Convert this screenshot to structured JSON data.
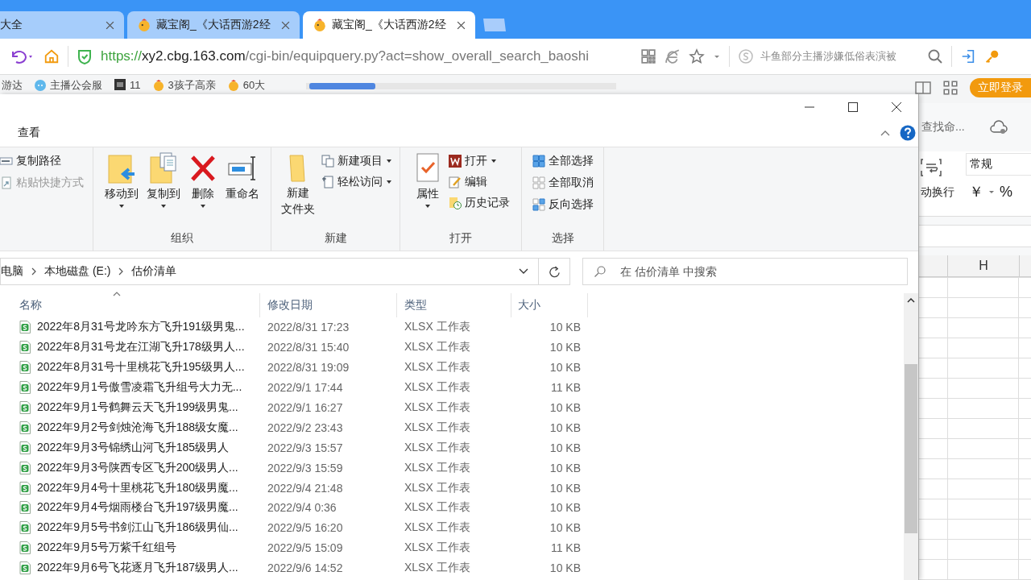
{
  "browser": {
    "tabs": [
      {
        "label": "大全",
        "selected": false,
        "favicon": false
      },
      {
        "label": "藏宝阁_《大话西游2经",
        "selected": false,
        "favicon": true
      },
      {
        "label": "藏宝阁_《大话西游2经",
        "selected": true,
        "favicon": true
      }
    ],
    "address": {
      "scheme": "https://",
      "host": "xy2.cbg.163.com",
      "path": "/cgi-bin/equipquery.py?act=show_overall_search_baoshi"
    },
    "search_text": "斗鱼部分主播涉嫌低俗表演被",
    "bookmarks": [
      {
        "label": "游达",
        "kind": "plain"
      },
      {
        "label": "主播公会服",
        "kind": "cloud"
      },
      {
        "label": "11",
        "kind": "dark"
      },
      {
        "label": "3孩子高亲",
        "kind": "chick"
      },
      {
        "label": "60大",
        "kind": "chick"
      }
    ],
    "login_button": "立即登录"
  },
  "explorer": {
    "ribbon_tab": "查看",
    "ribbon": {
      "clipboard": {
        "items": [
          {
            "label": "复制路径",
            "disabled": false
          },
          {
            "label": "粘贴快捷方式",
            "disabled": true
          }
        ]
      },
      "organize": {
        "label": "组织",
        "items": [
          {
            "label": "移动到",
            "dropdown": true
          },
          {
            "label": "复制到",
            "dropdown": true
          },
          {
            "label": "删除",
            "dropdown": true
          },
          {
            "label": "重命名",
            "dropdown": false
          }
        ]
      },
      "new": {
        "label": "新建",
        "folder": [
          "新建",
          "文件夹"
        ],
        "items": [
          {
            "label": "新建项目",
            "dropdown": true
          },
          {
            "label": "轻松访问",
            "dropdown": true
          }
        ]
      },
      "open": {
        "label": "打开",
        "properties": "属性",
        "items": [
          {
            "label": "打开",
            "dropdown": true
          },
          {
            "label": "编辑",
            "dropdown": false
          },
          {
            "label": "历史记录",
            "dropdown": false
          }
        ]
      },
      "select": {
        "label": "选择",
        "items": [
          "全部选择",
          "全部取消",
          "反向选择"
        ]
      }
    },
    "breadcrumb": [
      "电脑",
      "本地磁盘 (E:)",
      "估价清单"
    ],
    "search_placeholder": "在 估价清单 中搜索",
    "columns": [
      "名称",
      "修改日期",
      "类型",
      "大小"
    ],
    "files": [
      {
        "name": "2022年8月31号龙吟东方飞升191级男鬼...",
        "date": "2022/8/31 17:23",
        "type": "XLSX 工作表",
        "size": "10 KB"
      },
      {
        "name": "2022年8月31号龙在江湖飞升178级男人...",
        "date": "2022/8/31 15:40",
        "type": "XLSX 工作表",
        "size": "10 KB"
      },
      {
        "name": "2022年8月31号十里桃花飞升195级男人...",
        "date": "2022/8/31 19:09",
        "type": "XLSX 工作表",
        "size": "10 KB"
      },
      {
        "name": "2022年9月1号傲雪凌霜飞升组号大力无...",
        "date": "2022/9/1 17:44",
        "type": "XLSX 工作表",
        "size": "11 KB"
      },
      {
        "name": "2022年9月1号鹤舞云天飞升199级男鬼...",
        "date": "2022/9/1 16:27",
        "type": "XLSX 工作表",
        "size": "10 KB"
      },
      {
        "name": "2022年9月2号剑烛沧海飞升188级女魔...",
        "date": "2022/9/2 23:43",
        "type": "XLSX 工作表",
        "size": "10 KB"
      },
      {
        "name": "2022年9月3号锦绣山河飞升185级男人",
        "date": "2022/9/3 15:57",
        "type": "XLSX 工作表",
        "size": "10 KB"
      },
      {
        "name": "2022年9月3号陕西专区飞升200级男人...",
        "date": "2022/9/3 15:59",
        "type": "XLSX 工作表",
        "size": "10 KB"
      },
      {
        "name": "2022年9月4号十里桃花飞升180级男魔...",
        "date": "2022/9/4 21:48",
        "type": "XLSX 工作表",
        "size": "10 KB"
      },
      {
        "name": "2022年9月4号烟雨楼台飞升197级男魔...",
        "date": "2022/9/4 0:36",
        "type": "XLSX 工作表",
        "size": "10 KB"
      },
      {
        "name": "2022年9月5号书剑江山飞升186级男仙...",
        "date": "2022/9/5 16:20",
        "type": "XLSX 工作表",
        "size": "10 KB"
      },
      {
        "name": "2022年9月5号万紫千红组号",
        "date": "2022/9/5 15:09",
        "type": "XLSX 工作表",
        "size": "11 KB"
      },
      {
        "name": "2022年9月6号飞花逐月飞升187级男人...",
        "date": "2022/9/6 14:52",
        "type": "XLSX 工作表",
        "size": "10 KB"
      }
    ]
  },
  "spreadsheet": {
    "find": "查找命...",
    "wrap_label": "动换行",
    "number_format": "常规",
    "currency": "￥",
    "percent": "%",
    "column": "H"
  }
}
